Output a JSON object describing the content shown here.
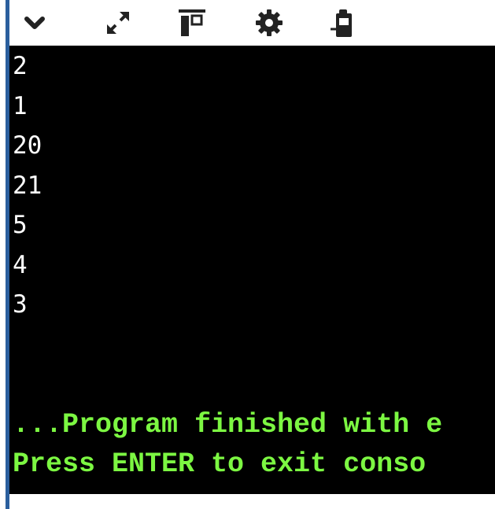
{
  "toolbar": {
    "buttons": [
      {
        "name": "collapse",
        "icon": "chevron-down-icon"
      },
      {
        "name": "maximize",
        "icon": "expand-icon"
      },
      {
        "name": "layout",
        "icon": "panel-toggle-icon"
      },
      {
        "name": "settings",
        "icon": "gear-icon"
      },
      {
        "name": "copy-output",
        "icon": "clipboard-icon"
      }
    ]
  },
  "console": {
    "output_lines": [
      "2",
      "1",
      "20",
      "21",
      "5",
      "4",
      "3"
    ],
    "status_line_1": "...Program finished with e",
    "status_line_2": "Press ENTER to exit conso"
  },
  "colors": {
    "console_bg": "#000000",
    "output_text": "#ffffff",
    "status_text": "#7cf742",
    "accent": "#2b5f9e",
    "icon": "#222222"
  }
}
